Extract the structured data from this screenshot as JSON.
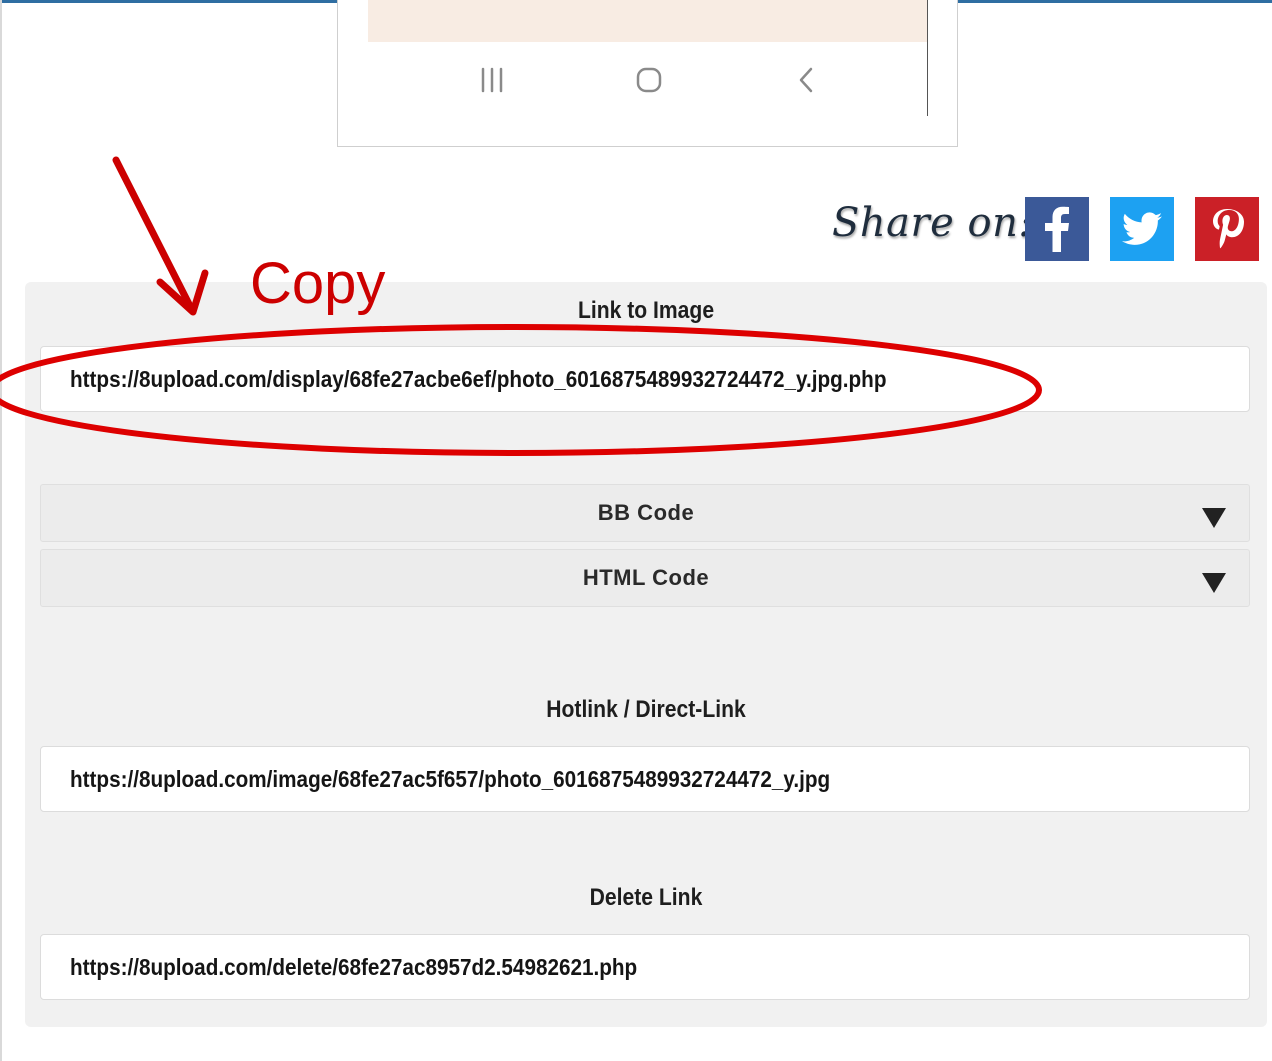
{
  "colors": {
    "accent_red": "#cc0000",
    "facebook": "#3b5998",
    "twitter": "#1da1f2",
    "pinterest": "#cb2027",
    "panel_bg": "#f1f1f1"
  },
  "preview": {
    "nav_icons": [
      "recents-icon",
      "home-icon",
      "back-icon"
    ]
  },
  "share": {
    "label": "Share on:",
    "buttons": [
      {
        "name": "facebook",
        "icon": "facebook-icon"
      },
      {
        "name": "twitter",
        "icon": "twitter-icon"
      },
      {
        "name": "pinterest",
        "icon": "pinterest-icon"
      }
    ]
  },
  "annotation": {
    "label": "Copy"
  },
  "links": {
    "link_to_image": {
      "title": "Link to Image",
      "value": "https://8upload.com/display/68fe27acbe6ef/photo_6016875489932724472_y.jpg.php"
    },
    "bb_code": {
      "label": "BB Code"
    },
    "html_code": {
      "label": "HTML Code"
    },
    "hotlink": {
      "title": "Hotlink / Direct-Link",
      "value": "https://8upload.com/image/68fe27ac5f657/photo_6016875489932724472_y.jpg"
    },
    "delete_link": {
      "title": "Delete Link",
      "value": "https://8upload.com/delete/68fe27ac8957d2.54982621.php"
    }
  }
}
